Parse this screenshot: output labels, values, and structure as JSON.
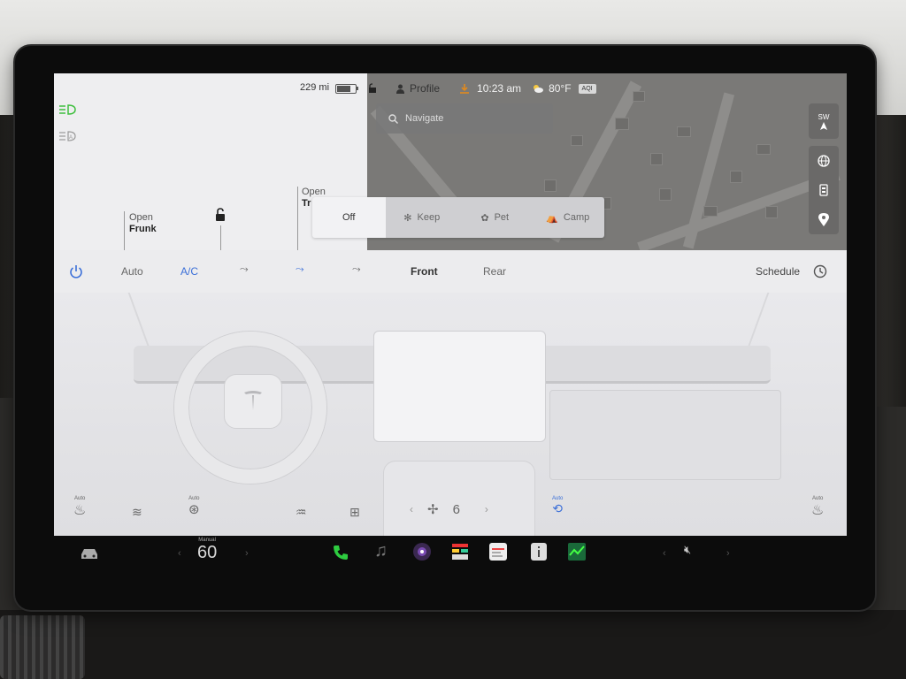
{
  "status": {
    "mileage": "229 mi",
    "profile": "Profile",
    "time": "10:23 am",
    "temperature": "80°F",
    "aqi": "AQI"
  },
  "car": {
    "frunk_open": "Open",
    "frunk_label": "Frunk",
    "trunk_open": "Open",
    "trunk_label": "Tr"
  },
  "map": {
    "search_placeholder": "Navigate",
    "compass_heading": "SW"
  },
  "modes": [
    {
      "label": "Off",
      "active": true
    },
    {
      "label": "Keep",
      "active": false
    },
    {
      "label": "Pet",
      "active": false
    },
    {
      "label": "Camp",
      "active": false
    }
  ],
  "climate": {
    "auto": "Auto",
    "ac": "A/C",
    "front": "Front",
    "rear": "Rear",
    "schedule": "Schedule",
    "fan_speed": "6",
    "seat_auto_left": "Auto",
    "steering_auto": "Auto",
    "recirc_auto": "Auto",
    "seat_auto_right": "Auto"
  },
  "dock": {
    "gear_label": "Manual",
    "speed": "60"
  },
  "colors": {
    "accent_blue": "#3b6fd8",
    "green_light": "#3fbf3f",
    "phone_green": "#2ecc40"
  }
}
